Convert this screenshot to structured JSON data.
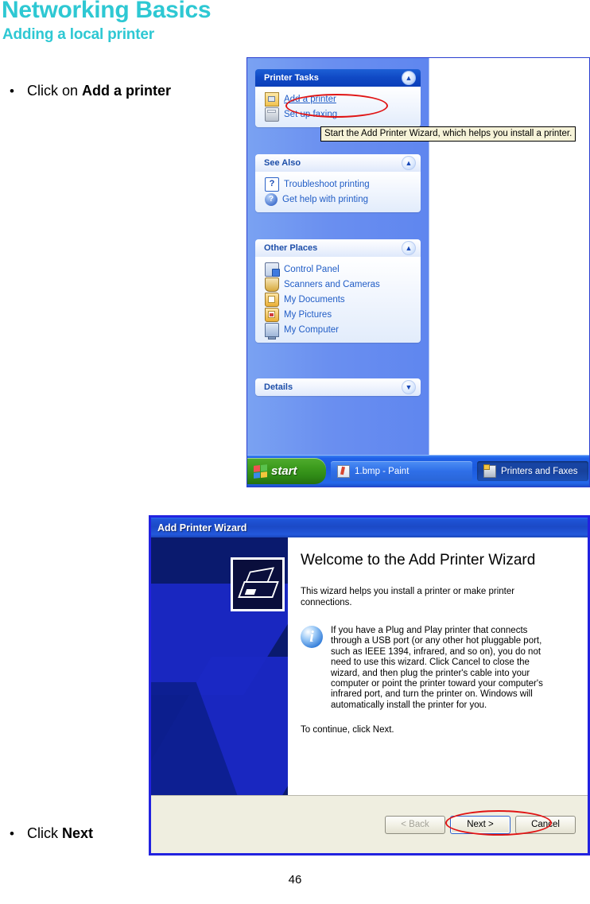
{
  "document": {
    "title": "Networking Basics",
    "subtitle": "Adding a local printer",
    "page_number": "46",
    "bullets": [
      {
        "bullet": "•",
        "text_before": "Click on ",
        "text_bold": "Add a printer"
      },
      {
        "bullet": "•",
        "text_before": "Click ",
        "text_bold": "Next"
      }
    ]
  },
  "screenshot_printers_folder": {
    "panels": [
      {
        "title": "Printer Tasks",
        "style": "dark",
        "chevron": "chevron-up-icon",
        "items": [
          {
            "label": "Add a printer",
            "icon": "add-printer-icon",
            "link": true
          },
          {
            "label": "Set up faxing",
            "icon": "fax-icon",
            "link": false
          }
        ]
      },
      {
        "title": "See Also",
        "style": "light",
        "chevron": "chevron-up-icon",
        "items": [
          {
            "label": "Troubleshoot printing",
            "icon": "help-question-icon",
            "link": false
          },
          {
            "label": "Get help with printing",
            "icon": "help-circle-icon",
            "link": false
          }
        ]
      },
      {
        "title": "Other Places",
        "style": "light",
        "chevron": "chevron-up-icon",
        "items": [
          {
            "label": "Control Panel",
            "icon": "control-panel-icon",
            "link": false
          },
          {
            "label": "Scanners and Cameras",
            "icon": "scanner-icon",
            "link": false
          },
          {
            "label": "My Documents",
            "icon": "my-documents-icon",
            "link": false
          },
          {
            "label": "My Pictures",
            "icon": "my-pictures-icon",
            "link": false
          },
          {
            "label": "My Computer",
            "icon": "my-computer-icon",
            "link": false
          }
        ]
      },
      {
        "title": "Details",
        "style": "light",
        "chevron": "chevron-down-icon",
        "items": []
      }
    ],
    "tooltip": "Start the Add Printer Wizard, which helps you install a printer.",
    "taskbar": {
      "start_label": "start",
      "buttons": [
        {
          "label": "1.bmp - Paint",
          "icon": "paint-icon",
          "active": false
        },
        {
          "label": "Printers and Faxes",
          "icon": "printer-icon",
          "active": true
        }
      ]
    }
  },
  "screenshot_add_printer_wizard": {
    "window_title": "Add Printer Wizard",
    "banner_icon": "printer-wizard-icon",
    "heading": "Welcome to the Add Printer Wizard",
    "paragraph": "This wizard helps you install a printer or make printer connections.",
    "note_icon": "info-icon",
    "note": "If you have a Plug and Play printer that connects through a USB port (or any other hot pluggable port, such as IEEE 1394, infrared, and so on), you do not need to use this wizard. Click Cancel to close the wizard, and then plug the printer's cable into your computer or point the printer toward your computer's infrared port, and turn the printer on. Windows will automatically install the printer for you.",
    "continue_text": "To continue, click Next.",
    "buttons": [
      {
        "label": "< Back",
        "state": "disabled"
      },
      {
        "label": "Next >",
        "state": "default"
      },
      {
        "label": "Cancel",
        "state": "normal"
      }
    ]
  },
  "annotations": {
    "accent_color": "#2ec8d3",
    "highlight_color": "#e01414",
    "ellipses": [
      "add-a-printer-highlight",
      "next-cancel-highlight"
    ]
  }
}
